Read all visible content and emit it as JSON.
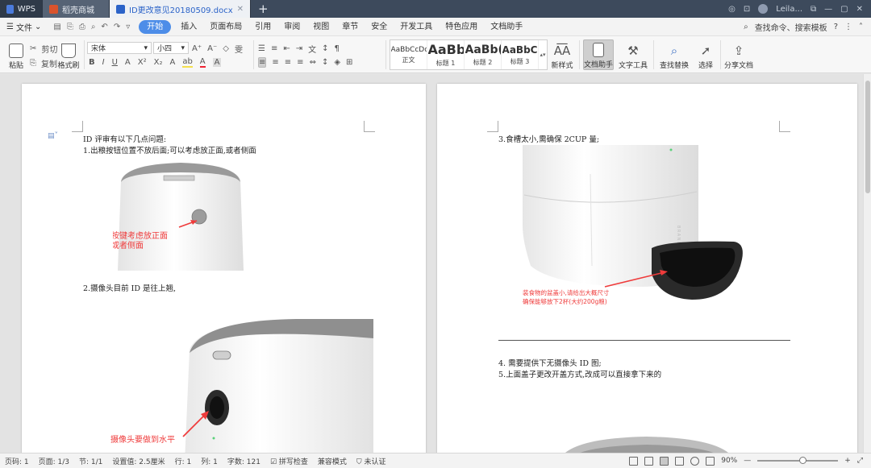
{
  "tabs": [
    {
      "label": "WPS",
      "logo_color": "#4b7bdc"
    },
    {
      "label": "稻壳商城",
      "logo_color": "#d9532c"
    },
    {
      "label": "ID更改意见20180509.docx",
      "logo_color": "#2b63c8"
    }
  ],
  "user": {
    "name": "Leila..."
  },
  "menu": {
    "file": "文件",
    "items": [
      "开始",
      "插入",
      "页面布局",
      "引用",
      "审阅",
      "视图",
      "章节",
      "安全",
      "开发工具",
      "特色应用",
      "文档助手"
    ],
    "active_index": 0,
    "search": "查找命令、搜索模板"
  },
  "ribbon": {
    "paste": "粘贴",
    "cut": "剪切",
    "copy": "复制",
    "format_painter": "格式刷",
    "font_name": "宋体",
    "font_size": "小四",
    "styles": [
      {
        "preview": "AaBbCcDd",
        "name": "正文"
      },
      {
        "preview": "AaBb",
        "name": "标题 1"
      },
      {
        "preview": "AaBb(",
        "name": "标题 2"
      },
      {
        "preview": "AaBbC",
        "name": "标题 3"
      }
    ],
    "new_style": "新样式",
    "doc_assistant": "文档助手",
    "text_tools": "文字工具",
    "find_replace": "查找替换",
    "select": "选择",
    "share": "分享文档"
  },
  "left_page": {
    "line1": "ID  评审有以下几点问题:",
    "line2": "1.出粮按钮位置不放后面;可以考虑放正面,或者侧面",
    "annotation1_line1": "按键考虑放正面",
    "annotation1_line2": "或者侧面",
    "line3": "2.摄像头目前 ID 是往上翘,",
    "annotation2": "摄像头要做到水平"
  },
  "right_page": {
    "line1": "3.食槽太小,需确保 2CUP 量;",
    "annotation1_line1": "装食物的盆盖小,请给出大概尺寸",
    "annotation1_line2": "确保能够放下2杯(大约200g粮)",
    "line2": "4. 需要提供下无摄像头 ID 图;",
    "line3": "5.上面盖子更改开盖方式,改成可以直接拿下来的",
    "brand_text": "BRAND"
  },
  "status": {
    "page_no": "页码: 1",
    "pages": "页面: 1/3",
    "section": "节: 1/1",
    "setting": "设置值: 2.5厘米",
    "row": "行: 1",
    "col": "列: 1",
    "words": "字数: 121",
    "spell": "拼写检查",
    "compat": "兼容模式",
    "cert": "未认证",
    "zoom": "90%"
  },
  "colors": {
    "accent": "#4d8de8",
    "annotation": "#ef3b3b"
  }
}
